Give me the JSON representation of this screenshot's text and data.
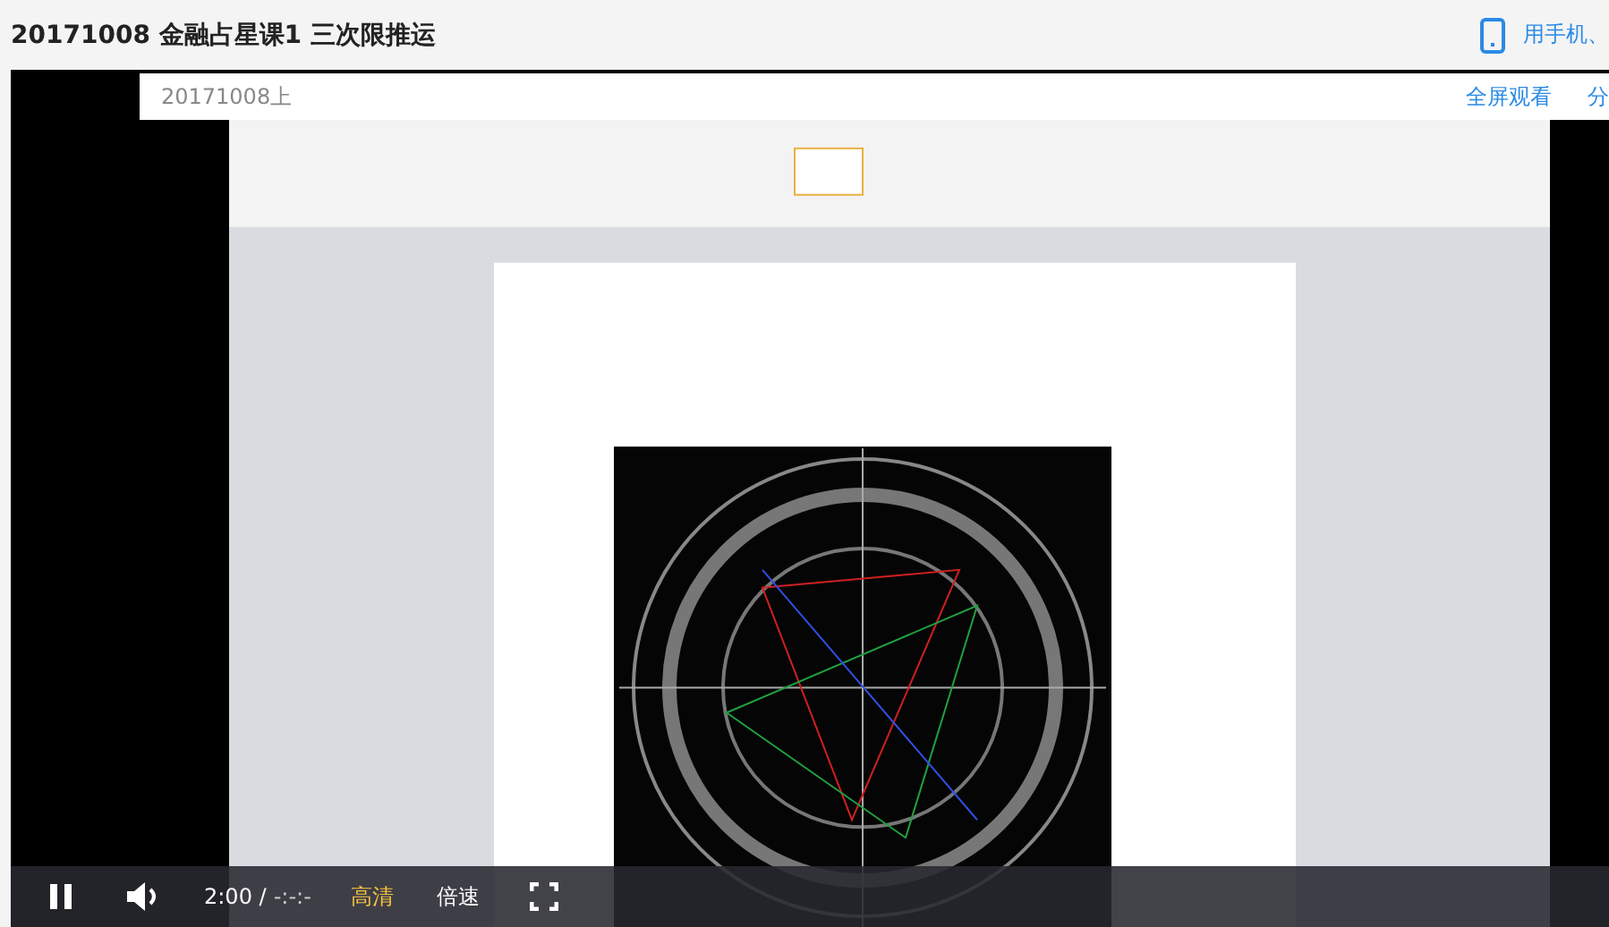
{
  "header": {
    "title": "20171008 金融占星课1 三次限推运",
    "mobile_link": "用手机、"
  },
  "player": {
    "top_bar": {
      "title": "20171008上",
      "fullscreen_link": "全屏观看",
      "share_link": "分"
    },
    "controls": {
      "playing": true,
      "time": "2:00",
      "separator": "/",
      "duration": "-:-:-",
      "quality": "高清",
      "speed": "倍速"
    }
  }
}
